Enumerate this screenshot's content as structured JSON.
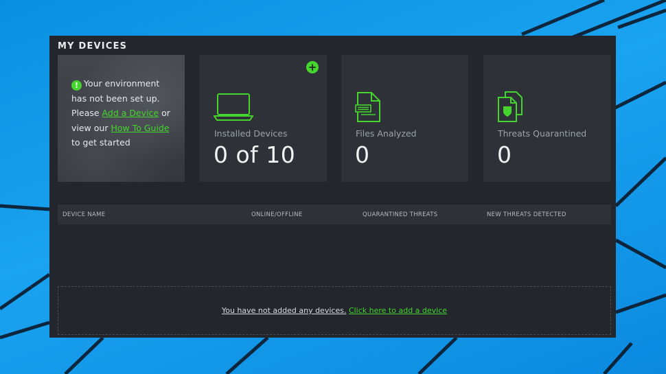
{
  "window": {
    "title": "MY DEVICES"
  },
  "setup": {
    "line_intro": "Your environment has not been set up. Please ",
    "add_device_link": "Add a Device",
    "line_mid": " or view our ",
    "guide_link": "How To Guide",
    "line_end": " to get started",
    "alert_icon": "!"
  },
  "stats": [
    {
      "label": "Installed Devices",
      "value": "0 of 10",
      "icon": "laptop-icon"
    },
    {
      "label": "Files Analyzed",
      "value": "0",
      "icon": "document-icon"
    },
    {
      "label": "Threats Quarantined",
      "value": "0",
      "icon": "quarantine-icon"
    }
  ],
  "add_button_symbol": "+",
  "table": {
    "columns": [
      "DEVICE NAME",
      "ONLINE/OFFLINE",
      "QUARANTINED THREATS",
      "NEW THREATS DETECTED"
    ]
  },
  "empty_state": {
    "message": "You have not added any devices.",
    "link": "Click here to add a device"
  },
  "colors": {
    "accent": "#44d62c",
    "panel": "#23262c",
    "card": "#2e3137",
    "desktop": "#1597e6"
  }
}
